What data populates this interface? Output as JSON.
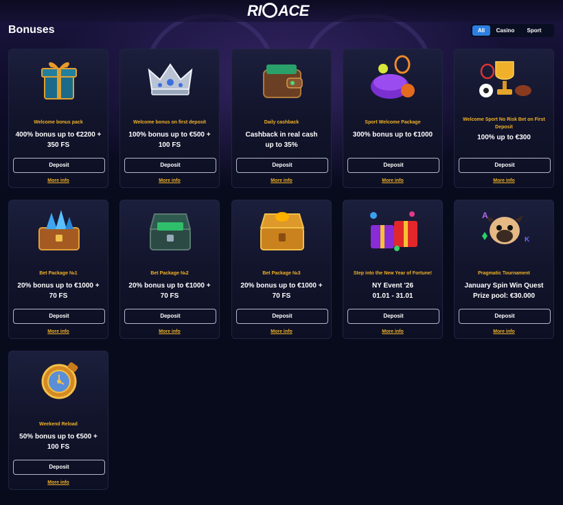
{
  "header": {
    "logo_text_left": "RI",
    "logo_text_right": "ACE"
  },
  "page": {
    "title": "Bonuses"
  },
  "filters": {
    "all": "All",
    "casino": "Casino",
    "sport": "Sport",
    "active": "All"
  },
  "cards": [
    {
      "subtitle": "Welcome bonus pack",
      "headline_1": "400% bonus up to €2200 +",
      "headline_2": "350 FS",
      "deposit": "Deposit",
      "more": "More info",
      "icon": "gift-box-icon"
    },
    {
      "subtitle": "Welcome bonus on first deposit",
      "headline_1": "100% bonus up to €500 +",
      "headline_2": "100 FS",
      "deposit": "Deposit",
      "more": "More info",
      "icon": "crown-icon"
    },
    {
      "subtitle": "Daily cashback",
      "headline_1": "Cashback in real cash",
      "headline_2": "up to 35%",
      "deposit": "Deposit",
      "more": "More info",
      "icon": "wallet-icon"
    },
    {
      "subtitle": "Sport Welcome Package",
      "headline_1": "300% bonus up to €1000",
      "headline_2": "",
      "deposit": "Deposit",
      "more": "More info",
      "icon": "sports-bag-icon"
    },
    {
      "subtitle": "Welcome Sport No Risk Bet on First Deposit",
      "headline_1": "100% up to €300",
      "headline_2": "",
      "deposit": "Deposit",
      "more": "More info",
      "icon": "trophy-icon"
    },
    {
      "subtitle": "Bet Package №1",
      "headline_1": "20% bonus up to €1000 +",
      "headline_2": "70 FS",
      "deposit": "Deposit",
      "more": "More info",
      "icon": "crystal-chest-icon"
    },
    {
      "subtitle": "Bet Package №2",
      "headline_1": "20% bonus up to €1000 +",
      "headline_2": "70 FS",
      "deposit": "Deposit",
      "more": "More info",
      "icon": "money-chest-icon"
    },
    {
      "subtitle": "Bet Package №3",
      "headline_1": "20% bonus up to €1000 +",
      "headline_2": "70 FS",
      "deposit": "Deposit",
      "more": "More info",
      "icon": "gold-chest-icon"
    },
    {
      "subtitle": "Step into the New Year of Fortune!",
      "headline_1": "NY Event '26",
      "headline_2": "01.01 - 31.01",
      "deposit": "Deposit",
      "more": "More info",
      "icon": "presents-icon"
    },
    {
      "subtitle": "Pragmatic Tournament",
      "headline_1": "January Spin Win Quest",
      "headline_2": "Prize pool: €30.000",
      "deposit": "Deposit",
      "more": "More info",
      "icon": "pug-icon"
    },
    {
      "subtitle": "Weekend Reload",
      "headline_1": "50% bonus up to €500 +",
      "headline_2": "100 FS",
      "deposit": "Deposit",
      "more": "More info",
      "icon": "golden-watch-icon"
    }
  ],
  "colors": {
    "accent": "#f2b327",
    "active_filter": "#2c7ee0",
    "background": "#070b1b"
  }
}
